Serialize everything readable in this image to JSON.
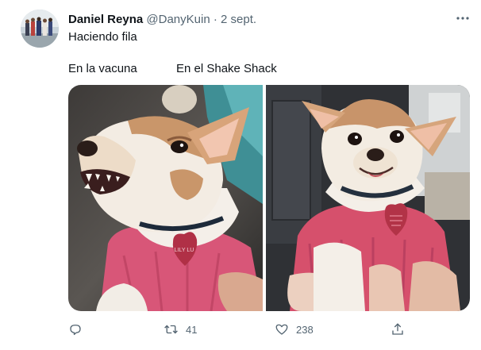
{
  "tweet": {
    "author_name": "Daniel Reyna",
    "handle": "@DanyKuin",
    "separator": "·",
    "date": "2 sept.",
    "text": "Haciendo fila",
    "caption_left": "En la vacuna",
    "caption_right": "En el Shake Shack"
  },
  "media": {
    "left_photo_tag_text": "LILY LU"
  },
  "actions": {
    "reply_icon": "reply-icon",
    "retweet_icon": "retweet-icon",
    "retweet_count": "41",
    "like_icon": "heart-icon",
    "like_count": "238",
    "share_icon": "share-icon",
    "more_icon": "more-icon"
  },
  "colors": {
    "text_primary": "#0f1419",
    "text_secondary": "#536471",
    "background": "#ffffff"
  }
}
